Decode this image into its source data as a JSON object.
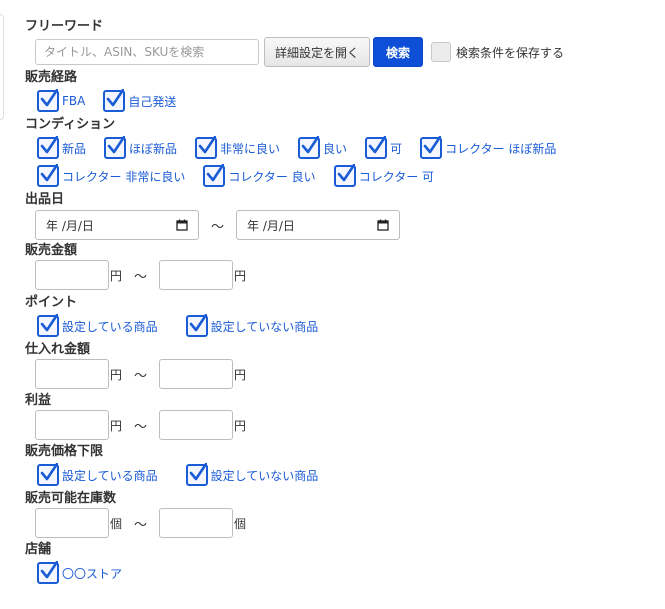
{
  "free_word": {
    "label": "フリーワード",
    "placeholder": "タイトル、ASIN、SKUを検索",
    "detail_button": "詳細設定を開く",
    "search_button": "検索",
    "save_label": "検索条件を保存する",
    "save_checked": false
  },
  "channel": {
    "label": "販売経路",
    "options": [
      {
        "label": "FBA",
        "checked": true
      },
      {
        "label": "自己発送",
        "checked": true
      }
    ]
  },
  "condition": {
    "label": "コンディション",
    "options": [
      {
        "label": "新品",
        "checked": true
      },
      {
        "label": "ほぼ新品",
        "checked": true
      },
      {
        "label": "非常に良い",
        "checked": true
      },
      {
        "label": "良い",
        "checked": true
      },
      {
        "label": "可",
        "checked": true
      },
      {
        "label": "コレクター ほぼ新品",
        "checked": true
      },
      {
        "label": "コレクター 非常に良い",
        "checked": true
      },
      {
        "label": "コレクター 良い",
        "checked": true
      },
      {
        "label": "コレクター 可",
        "checked": true
      }
    ]
  },
  "listing_date": {
    "label": "出品日",
    "from_text": "年 /月/日",
    "to_text": "年 /月/日",
    "tilde": "〜"
  },
  "sale_price": {
    "label": "販売金額",
    "unit_from": "円",
    "unit_to": "円",
    "tilde": "〜"
  },
  "points": {
    "label": "ポイント",
    "options": [
      {
        "label": "設定している商品",
        "checked": true
      },
      {
        "label": "設定していない商品",
        "checked": true
      }
    ]
  },
  "purchase_price": {
    "label": "仕入れ金額",
    "unit_from": "円",
    "unit_to": "円",
    "tilde": "〜"
  },
  "profit": {
    "label": "利益",
    "unit_from": "円",
    "unit_to": "円",
    "tilde": "〜"
  },
  "min_price": {
    "label": "販売価格下限",
    "options": [
      {
        "label": "設定している商品",
        "checked": true
      },
      {
        "label": "設定していない商品",
        "checked": true
      }
    ]
  },
  "stock": {
    "label": "販売可能在庫数",
    "unit_from": "個",
    "unit_to": "個",
    "tilde": "〜"
  },
  "store": {
    "label": "店舗",
    "options": [
      {
        "label": "〇〇ストア",
        "checked": true
      }
    ]
  },
  "colors": {
    "accent": "#1a5bd6",
    "button_blue": "#0d4fd6"
  }
}
